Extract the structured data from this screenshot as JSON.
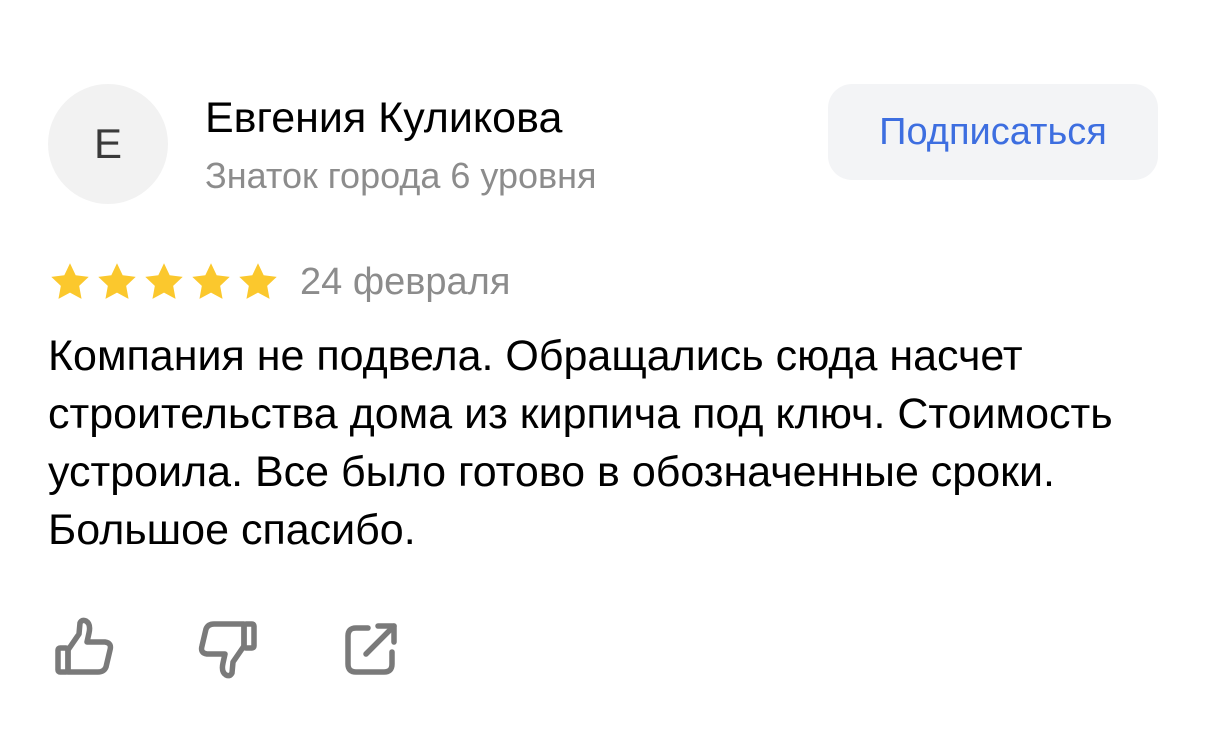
{
  "author": {
    "initial": "Е",
    "name": "Евгения Куликова",
    "level": "Знаток города 6 уровня"
  },
  "subscribe": {
    "label": "Подписаться"
  },
  "review": {
    "rating": 5,
    "rating_max": 5,
    "date": "24 февраля",
    "text": "Компания не подвела. Обращались сюда насчет строительства дома из кирпича под ключ. Стоимость устроила. Все было готово в обозначенные сроки. Большое спасибо."
  },
  "actions": {
    "like_icon": "thumbs-up-icon",
    "dislike_icon": "thumbs-down-icon",
    "share_icon": "share-icon"
  },
  "colors": {
    "star": "#fbc82d",
    "accent": "#3d6ee0",
    "muted": "#8c8c8c",
    "icon": "#7a7a7a",
    "button_bg": "#f3f4f6"
  }
}
